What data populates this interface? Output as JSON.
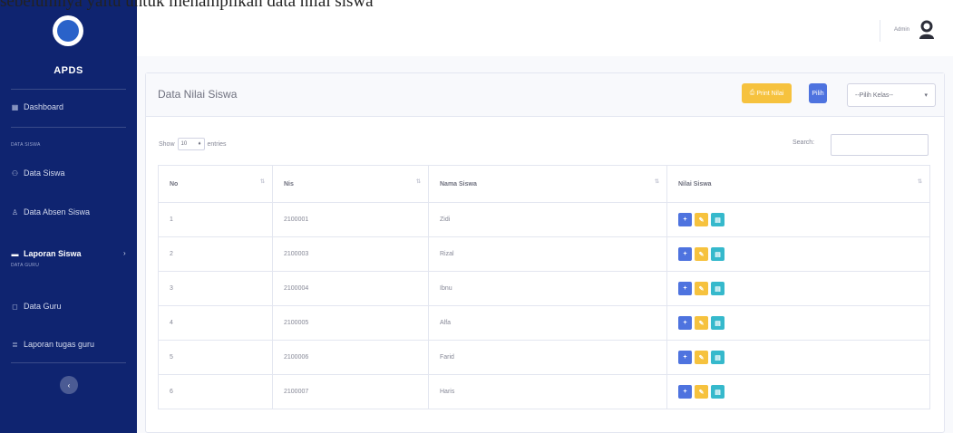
{
  "caption": "sebelumnya yaitu untuk menampilkan data nilai siswa",
  "sidebar": {
    "brand": "APDS",
    "items": [
      {
        "label": "Dashboard",
        "icon": "dashboard-icon"
      },
      {
        "label": "Data Siswa",
        "icon": "users-icon"
      },
      {
        "label": "Data Absen Siswa",
        "icon": "user-check-icon"
      },
      {
        "label": "Laporan Siswa",
        "icon": "folder-icon"
      },
      {
        "label": "Data Guru",
        "icon": "chat-icon"
      },
      {
        "label": "Laporan tugas guru",
        "icon": "list-icon"
      }
    ],
    "headings": [
      "DATA SISWA",
      "DATA GURU"
    ]
  },
  "topbar": {
    "user_name": "Admin"
  },
  "card": {
    "title": "Data Nilai Siswa",
    "print_label": "Print Nilai",
    "pilih_label": "Pilih",
    "kelas_select": "--Pilih Kelas--"
  },
  "table_controls": {
    "show_label": "Show",
    "entries_value": "10",
    "entries_label": "entries",
    "search_label": "Search:"
  },
  "table": {
    "headers": [
      "No",
      "Nis",
      "Nama Siswa",
      "Nilai Siswa"
    ],
    "rows": [
      {
        "no": "1",
        "nis": "2100001",
        "nama": "Zidi"
      },
      {
        "no": "2",
        "nis": "2100003",
        "nama": "Rizal"
      },
      {
        "no": "3",
        "nis": "2100004",
        "nama": "Ibnu"
      },
      {
        "no": "4",
        "nis": "2100005",
        "nama": "Alfa"
      },
      {
        "no": "5",
        "nis": "2100006",
        "nama": "Farid"
      },
      {
        "no": "6",
        "nis": "2100007",
        "nama": "Haris"
      }
    ]
  },
  "colors": {
    "sidebar": "#0f2470",
    "primary": "#4e73df",
    "warning": "#f6c23e",
    "info": "#36b9cc"
  }
}
